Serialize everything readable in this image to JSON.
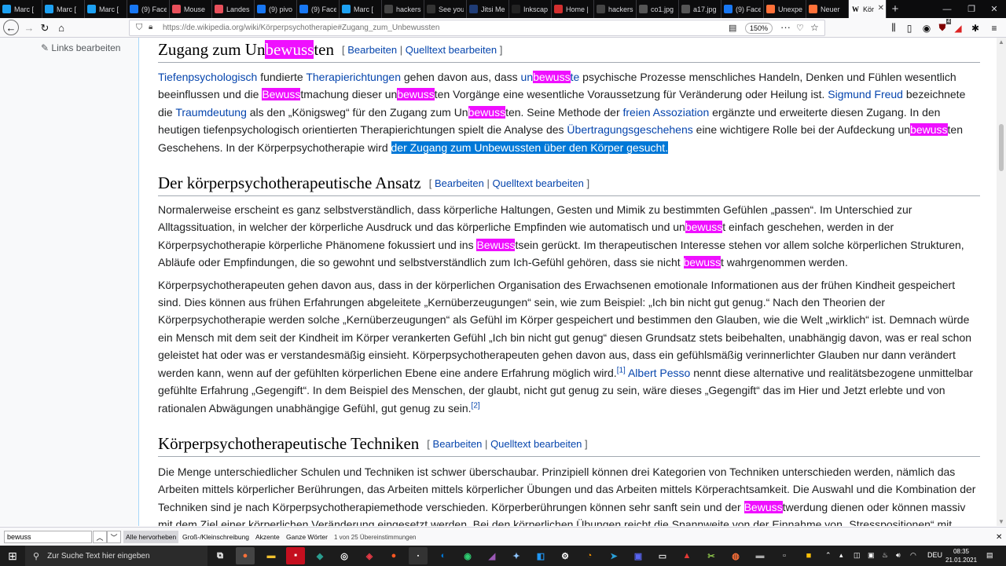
{
  "browser": {
    "tabs": [
      {
        "label": "Marc [",
        "icon": "twitter-icon",
        "color": "#1da1f2"
      },
      {
        "label": "Marc [",
        "icon": "twitter-icon",
        "color": "#1da1f2"
      },
      {
        "label": "Marc [",
        "icon": "twitter-icon",
        "color": "#1da1f2"
      },
      {
        "label": "(9) Face",
        "icon": "facebook-icon",
        "color": "#1877f2"
      },
      {
        "label": "Mouse",
        "icon": "page-icon",
        "color": "#e8505b"
      },
      {
        "label": "Landes",
        "icon": "page-icon",
        "color": "#e8505b"
      },
      {
        "label": "(9) pivo",
        "icon": "facebook-icon",
        "color": "#1877f2"
      },
      {
        "label": "(9) Face",
        "icon": "facebook-icon",
        "color": "#1877f2"
      },
      {
        "label": "Marc [",
        "icon": "twitter-icon",
        "color": "#1da1f2"
      },
      {
        "label": "hackersca",
        "icon": "page-icon",
        "color": "#444444"
      },
      {
        "label": "See you",
        "icon": "page-icon",
        "color": "#333333"
      },
      {
        "label": "Jitsi Me",
        "icon": "page-icon",
        "color": "#1f3c76"
      },
      {
        "label": "Inkscap",
        "icon": "page-icon",
        "color": "#222222"
      },
      {
        "label": "Home |",
        "icon": "page-icon",
        "color": "#d32f2f"
      },
      {
        "label": "hackersca",
        "icon": "page-icon",
        "color": "#444444"
      },
      {
        "label": "co1.jpg (JPE",
        "icon": "page-icon",
        "color": "#555555"
      },
      {
        "label": "a17.jpg (JPE",
        "icon": "page-icon",
        "color": "#555555"
      },
      {
        "label": "(9) Face",
        "icon": "facebook-icon",
        "color": "#1877f2"
      },
      {
        "label": "Unexpe",
        "icon": "firefox-icon",
        "color": "#ff7139"
      },
      {
        "label": "Neuer",
        "icon": "firefox-icon",
        "color": "#ff7139"
      }
    ],
    "active_tab": {
      "label": "Kör",
      "icon": "wikipedia-icon"
    },
    "new_tab": "+",
    "url": "https://de.wikipedia.org/wiki/Körperpsychotherapie#Zugang_zum_Unbewussten",
    "zoom": "150%",
    "ublock_count": "4"
  },
  "sidebar": {
    "links_label": "Links bearbeiten"
  },
  "article": {
    "edit_open": "[",
    "edit_sep": "|",
    "edit_close": "]",
    "edit_label": "Bearbeiten",
    "source_label": "Quelltext bearbeiten",
    "s1": {
      "title_pre": "Zugang zum Un",
      "title_hl": "bewuss",
      "title_post": "ten",
      "t01": "Tiefenpsychologisch",
      "t02": " fundierte ",
      "t03": "Therapierichtungen",
      "t04": " gehen davon aus, dass ",
      "t05": "un",
      "t06": "bewuss",
      "t07": "te",
      "t08": " psychische Prozesse menschliches Handeln, Denken und Fühlen wesentlich beeinflussen und die ",
      "t09": "Bewuss",
      "t10": "tmachung dieser un",
      "t11": "bewuss",
      "t12": "ten Vorgänge eine wesentliche Voraussetzung für Veränderung oder Heilung ist. ",
      "t13": "Sigmund Freud",
      "t14": " bezeichnete die ",
      "t15": "Traumdeutung",
      "t16": " als den „Königsweg“ für den Zugang zum Un",
      "t17": "bewuss",
      "t18": "ten. Seine Methode der ",
      "t19": "freien Assoziation",
      "t20": " ergänzte und erweiterte diesen Zugang. In den heutigen tiefenpsychologisch orientierten Therapierichtungen spielt die Analyse des ",
      "t21": "Übertragungsgeschehens",
      "t22": " eine wichtigere Rolle bei der Aufdeckung un",
      "t23": "bewuss",
      "t24": "ten Geschehens. In der Körperpsychotherapie wird ",
      "t25": "der Zugang zum Unbewussten über den Körper gesucht."
    },
    "s2": {
      "title": "Der körperpsychotherapeutische Ansatz",
      "p1a": "Normalerweise erscheint es ganz selbstverständlich, dass körperliche Haltungen, Gesten und Mimik zu bestimmten Gefühlen „passen“. Im Unterschied zur Alltagssituation, in welcher der körperliche Ausdruck und das körperliche Empfinden wie automatisch und un",
      "p1b": "bewuss",
      "p1c": "t einfach geschehen, werden in der Körperpsychotherapie körperliche Phänomene fokussiert und ins ",
      "p1d": "Bewuss",
      "p1e": "tsein gerückt. Im therapeutischen Interesse stehen vor allem solche körperlichen Strukturen, Abläufe oder Empfindungen, die so gewohnt und selbstverständlich zum Ich-Gefühl gehören, dass sie nicht ",
      "p1f": "bewuss",
      "p1g": "t wahrgenommen werden.",
      "p2a": "Körperpsychotherapeuten gehen davon aus, dass in der körperlichen Organisation des Erwachsenen emotionale Informationen aus der frühen Kindheit gespeichert sind. Dies können aus frühen Erfahrungen abgeleitete „Kernüberzeugungen“ sein, wie zum Beispiel: „Ich bin nicht gut genug.“ Nach den Theorien der Körperpsychotherapie werden solche „Kernüberzeugungen“ als Gefühl im Körper gespeichert und bestimmen den Glauben, wie die Welt „wirklich“ ist. Demnach würde ein Mensch mit dem seit der Kindheit im Körper verankerten Gefühl „Ich bin nicht gut genug“ diesen Grundsatz stets beibehalten, unabhängig davon, was er real schon geleistet hat oder was er verstandesmäßig einsieht. Körperpsychotherapeuten gehen davon aus, dass ein gefühlsmäßig verinnerlichter Glauben nur dann verändert werden kann, wenn auf der gefühlten körperlichen Ebene eine andere Erfahrung möglich wird.",
      "ref1": "[1]",
      "p2b": " ",
      "p2c": "Albert Pesso",
      "p2d": " nennt diese alternative und realitätsbezogene unmittelbar gefühlte Erfahrung „Gegengift“. In dem Beispiel des Menschen, der glaubt, nicht gut genug zu sein, wäre dieses „Gegengift“ das im Hier und Jetzt erlebte und von rationalen Abwägungen unabhängige Gefühl, gut genug zu sein.",
      "ref2": "[2]"
    },
    "s3": {
      "title": "Körperpsychotherapeutische Techniken",
      "p1a": "Die Menge unterschiedlicher Schulen und Techniken ist schwer überschaubar. Prinzipiell können drei Kategorien von Techniken unterschieden werden, nämlich das Arbeiten mittels körperlicher Berührungen, das Arbeiten mittels körperlicher Übungen und das Arbeiten mittels Körperachtsamkeit. Die Auswahl und die Kombination der Techniken sind je nach Körperpsychotherapiemethode verschieden. Körperberührungen können sehr sanft sein und der ",
      "p1b": "Bewuss",
      "p1c": "twerdung dienen oder können massiv mit dem Ziel einer körperlichen Veränderung eingesetzt werden. Bei den körperlichen Übungen reicht die Spannweite von der Einnahme von „Stresspositionen“ mit"
    }
  },
  "findbar": {
    "query": "bewuss",
    "highlight_all": "Alle hervorheben",
    "match_case": "Groß-/Kleinschreibung",
    "diacritics": "Akzente",
    "whole_words": "Ganze Wörter",
    "status": "1 von 25 Übereinstimmungen"
  },
  "taskbar": {
    "search_placeholder": "Zur Suche Text hier eingeben",
    "language": "DEU",
    "time": "08:35",
    "date": "21.01.2021"
  },
  "colors": {
    "highlight": "#ef0fff",
    "selection": "#0078d7",
    "link": "#0645ad"
  }
}
